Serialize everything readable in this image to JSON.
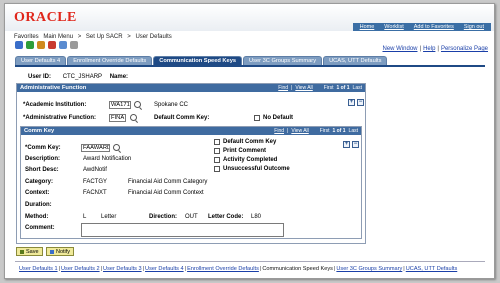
{
  "header": {
    "logo": "ORACLE",
    "links": [
      "Home",
      "Worklist",
      "Add to Favorites",
      "Sign out"
    ]
  },
  "breadcrumb": [
    "Favorites",
    "Main Menu",
    ">",
    "Set Up SACR",
    ">",
    "User Defaults"
  ],
  "toolbar": {
    "new_window": "New Window",
    "help": "Help",
    "personalize": "Personalize Page",
    "icons": [
      "help-icon",
      "info-icon",
      "gear-icon",
      "add-icon",
      "worklist-icon",
      "notepad-icon"
    ]
  },
  "tabs": [
    "User Defaults 4",
    "Enrollment Override Defaults",
    "Communication Speed Keys",
    "User 3C Groups Summary",
    "UCAS, UTT Defaults"
  ],
  "active_tab": "Communication Speed Keys",
  "user": {
    "id_label": "User ID:",
    "id_value": "CTC_JSHARP",
    "name_label": "Name:"
  },
  "admin_function": {
    "title": "Administrative Function",
    "nav": {
      "find": "Find",
      "view_all": "View All",
      "first": "First",
      "range": "1 of 1",
      "last": "Last"
    },
    "institution_label": "*Academic Institution:",
    "institution_value": "WA171",
    "institution_desc": "Spokane CC",
    "function_label": "*Administrative Function:",
    "function_value": "FINA",
    "default_key_label": "Default Comm Key:",
    "no_default_label": "No Default"
  },
  "comm_key": {
    "title": "Comm Key",
    "nav": {
      "find": "Find",
      "view_all": "View All",
      "first": "First",
      "range": "1 of 1",
      "last": "Last"
    },
    "key_label": "*Comm Key:",
    "key_value": "FAAWARD",
    "description_label": "Description:",
    "description_value": "Award Notification",
    "short_desc_label": "Short Desc:",
    "short_desc_value": "AwdNotif",
    "category_label": "Category:",
    "category_value": "FACTGY",
    "category_desc": "Financial Aid Comm Category",
    "context_label": "Context:",
    "context_value": "FACNXT",
    "context_desc": "Financial Aid Comm Context",
    "duration_label": "Duration:",
    "method_label": "Method:",
    "method_value": "L",
    "method_desc": "Letter",
    "direction_label": "Direction:",
    "direction_value": "OUT",
    "letter_code_label": "Letter Code:",
    "letter_code_value": "L80",
    "comment_label": "Comment:",
    "checkboxes": [
      "Default Comm Key",
      "Print Comment",
      "Activity Completed",
      "Unsuccessful Outcome"
    ]
  },
  "buttons": {
    "save": "Save",
    "notify": "Notify"
  },
  "footer_links": [
    "User Defaults 1",
    "User Defaults 2",
    "User Defaults 3",
    "User Defaults 4",
    "Enrollment Override Defaults",
    "Communication Speed Keys",
    "User 3C Groups Summary",
    "UCAS, UTT Defaults"
  ],
  "colors": {
    "accent": "#1f4a85",
    "brand": "#e0261b",
    "link": "#1a3fa8"
  }
}
